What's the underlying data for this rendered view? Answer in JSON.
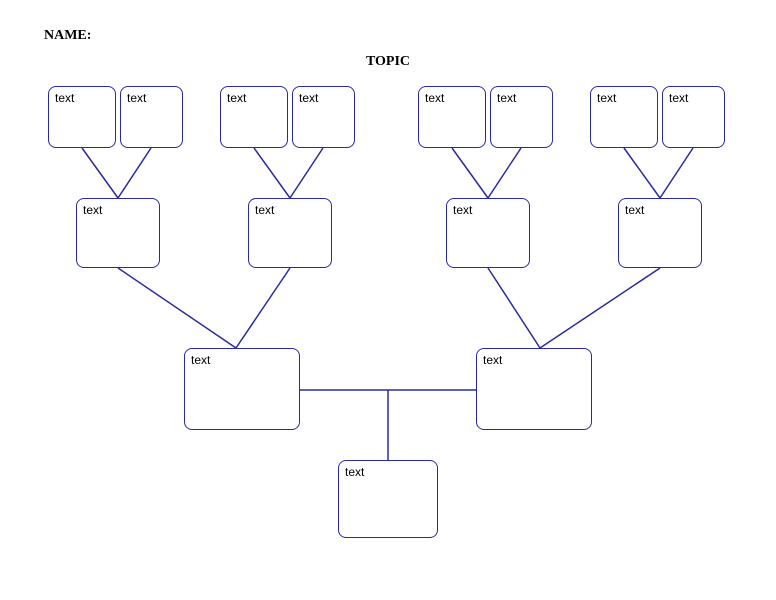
{
  "header": {
    "name_label": "NAME:",
    "topic_label": "TOPIC"
  },
  "nodes": {
    "row1": [
      {
        "label": "text"
      },
      {
        "label": "text"
      },
      {
        "label": "text"
      },
      {
        "label": "text"
      },
      {
        "label": "text"
      },
      {
        "label": "text"
      },
      {
        "label": "text"
      },
      {
        "label": "text"
      }
    ],
    "row2": [
      {
        "label": "text"
      },
      {
        "label": "text"
      },
      {
        "label": "text"
      },
      {
        "label": "text"
      }
    ],
    "row3": [
      {
        "label": "text"
      },
      {
        "label": "text"
      }
    ],
    "row4": [
      {
        "label": "text"
      }
    ]
  },
  "colors": {
    "stroke": "#2a2aa0"
  }
}
